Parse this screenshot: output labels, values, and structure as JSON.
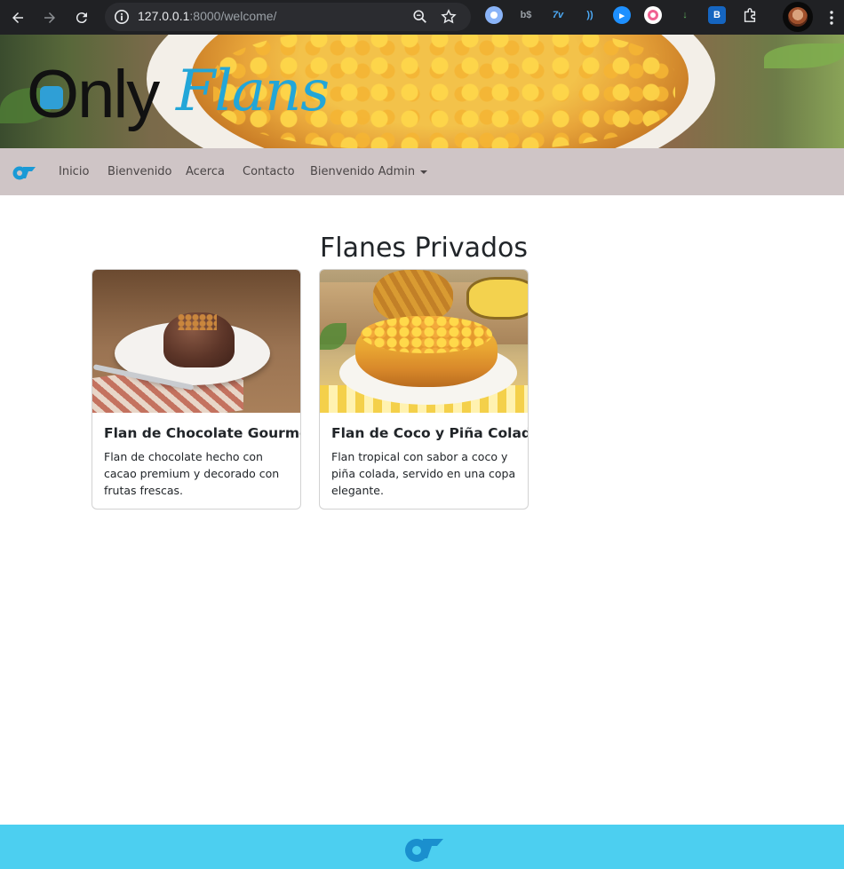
{
  "browser": {
    "url_host": "127.0.0.1",
    "url_rest": ":8000/welcome/",
    "icons": [
      "back-icon",
      "forward-icon",
      "reload-icon",
      "site-info-icon",
      "zoom-icon",
      "bookmark-star-icon",
      "extensions-puzzle-icon",
      "more-menu-icon"
    ]
  },
  "banner": {
    "logo_part1": "Only",
    "logo_part2": "Flans"
  },
  "navbar": {
    "items": [
      {
        "label": "Inicio"
      },
      {
        "label": "Bienvenido"
      },
      {
        "label": "Acerca"
      },
      {
        "label": "Contacto"
      },
      {
        "label": "Bienvenido Admin"
      }
    ]
  },
  "main": {
    "title": "Flanes Privados",
    "cards": [
      {
        "title": "Flan de Chocolate Gourmet",
        "text": "Flan de chocolate hecho con cacao premium y decorado con frutas frescas."
      },
      {
        "title": "Flan de Coco y Piña Colada",
        "text": "Flan tropical con sabor a coco y piña colada, servido en una copa elegante."
      }
    ]
  },
  "colors": {
    "navbar_bg": "#cfc5c6",
    "footer_bg": "#4ccff0",
    "brand_blue": "#22a6d8",
    "chrome_bg": "#202124"
  }
}
